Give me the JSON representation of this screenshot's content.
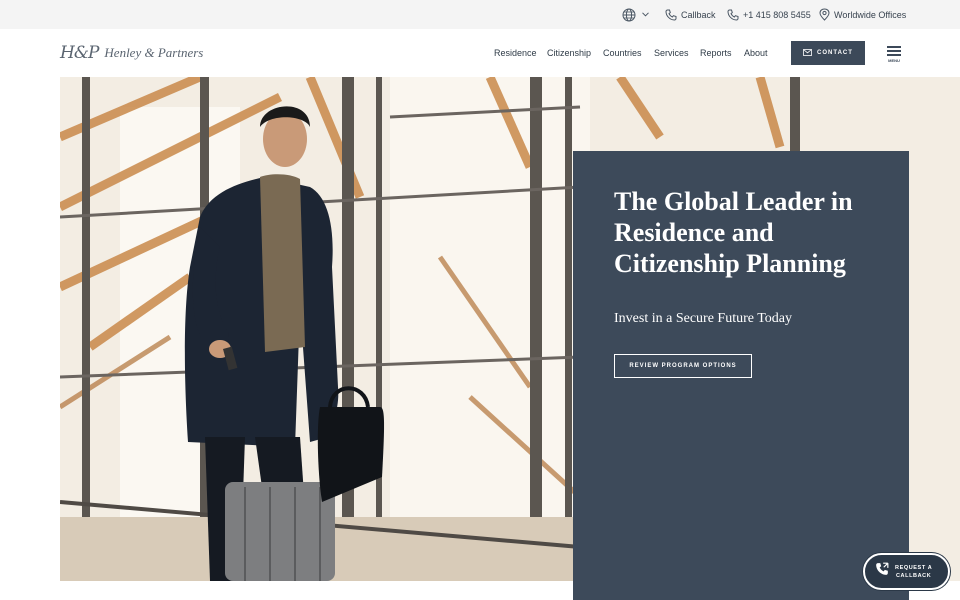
{
  "utility_bar": {
    "callback_label": "Callback",
    "phone_label": "+1 415 808 5455",
    "offices_label": "Worldwide Offices"
  },
  "header": {
    "logo_mark": "H&P",
    "logo_text": "Henley & Partners",
    "nav": [
      "Residence",
      "Citizenship",
      "Countries",
      "Services",
      "Reports",
      "About"
    ],
    "contact_label": "CONTACT",
    "menu_label": "MENU"
  },
  "hero": {
    "title": "The Global Leader in Residence and Citizenship Planning",
    "subtitle": "Invest in a Secure Future Today",
    "cta_label": "REVIEW PROGRAM OPTIONS"
  },
  "callback_widget": {
    "line1": "REQUEST A",
    "line2": "CALLBACK"
  },
  "colors": {
    "panel": "#3d4a5a",
    "utility_bg": "#f4f4f4",
    "text_dark": "#2f3b47"
  }
}
